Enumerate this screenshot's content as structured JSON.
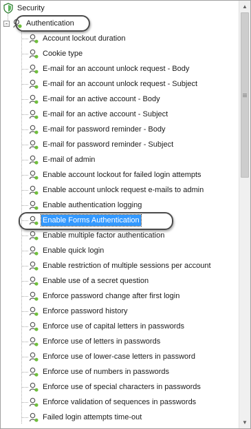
{
  "tree": {
    "root": {
      "label": "Security",
      "icon": "shield-icon"
    },
    "group": {
      "label": "Authentication",
      "icon": "key-group-icon",
      "expander": "-"
    },
    "items": [
      {
        "label": "Account lockout duration"
      },
      {
        "label": "Cookie type"
      },
      {
        "label": "E-mail for an account unlock request - Body"
      },
      {
        "label": "E-mail for an account unlock request - Subject"
      },
      {
        "label": "E-mail for an active account - Body"
      },
      {
        "label": "E-mail for an active account - Subject"
      },
      {
        "label": "E-mail for password reminder - Body"
      },
      {
        "label": "E-mail for password reminder - Subject"
      },
      {
        "label": "E-mail of admin"
      },
      {
        "label": "Enable account lockout for failed login attempts"
      },
      {
        "label": "Enable account unlock request e-mails to admin"
      },
      {
        "label": "Enable authentication logging"
      },
      {
        "label": "Enable Forms Authentication"
      },
      {
        "label": "Enable multiple factor authentication"
      },
      {
        "label": "Enable quick login"
      },
      {
        "label": "Enable restriction of multiple sessions per account"
      },
      {
        "label": "Enable use of a secret question"
      },
      {
        "label": "Enforce password change after first login"
      },
      {
        "label": "Enforce password history"
      },
      {
        "label": "Enforce use of capital letters in passwords"
      },
      {
        "label": "Enforce use of letters in passwords"
      },
      {
        "label": "Enforce use of lower-case letters in password"
      },
      {
        "label": "Enforce use of numbers in passwords"
      },
      {
        "label": "Enforce use of special characters in passwords"
      },
      {
        "label": "Enforce validation of sequences in passwords"
      },
      {
        "label": "Failed login attempts time-out"
      }
    ],
    "selected_index": 12,
    "item_icon": "setting-node-icon"
  },
  "scrollbar": {
    "up_glyph": "▲",
    "down_glyph": "▼",
    "position_fraction": 0.0,
    "visible_fraction": 0.39
  },
  "colors": {
    "selection": "#3399ff",
    "shield_green": "#3c9a3c",
    "node_green": "#5a9e2f"
  }
}
